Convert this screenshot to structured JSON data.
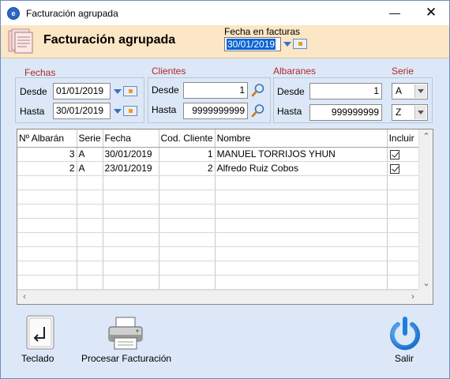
{
  "window": {
    "title": "Facturación agrupada",
    "minimize": "—",
    "close": "✕"
  },
  "header": {
    "title": "Facturación agrupada",
    "fecha_label": "Fecha en facturas",
    "fecha_value": "30/01/2019"
  },
  "filters": {
    "fechas": {
      "label": "Fechas",
      "desde_label": "Desde",
      "desde": "01/01/2019",
      "hasta_label": "Hasta",
      "hasta": "30/01/2019"
    },
    "clientes": {
      "label": "Clientes",
      "desde_label": "Desde",
      "desde": "1",
      "hasta_label": "Hasta",
      "hasta": "9999999999"
    },
    "albaranes": {
      "label": "Albaranes",
      "desde_label": "Desde",
      "desde": "1",
      "hasta_label": "Hasta",
      "hasta": "999999999"
    },
    "serie": {
      "label": "Serie",
      "desde": "A",
      "hasta": "Z"
    }
  },
  "table": {
    "columns": [
      "Nº Albarán",
      "Serie",
      "Fecha",
      "Cod. Cliente",
      "Nombre",
      "Incluir"
    ],
    "rows": [
      {
        "albaran": "3",
        "serie": "A",
        "fecha": "30/01/2019",
        "cliente": "1",
        "nombre": "MANUEL TORRIJOS YHUN",
        "incluir": true
      },
      {
        "albaran": "2",
        "serie": "A",
        "fecha": "23/01/2019",
        "cliente": "2",
        "nombre": "Alfredo Ruiz Cobos",
        "incluir": true
      }
    ]
  },
  "buttons": {
    "teclado": "Teclado",
    "procesar": "Procesar Facturación",
    "salir": "Salir"
  },
  "colors": {
    "accent": "#0a64d4",
    "section_label": "#b3262b",
    "header_band": "#fbe6c6",
    "window_bg": "#dce8f7"
  },
  "icons": [
    "app-icon",
    "invoices-icon",
    "calendar-icon",
    "search-icon",
    "keyboard-enter-icon",
    "printer-icon",
    "power-icon"
  ]
}
